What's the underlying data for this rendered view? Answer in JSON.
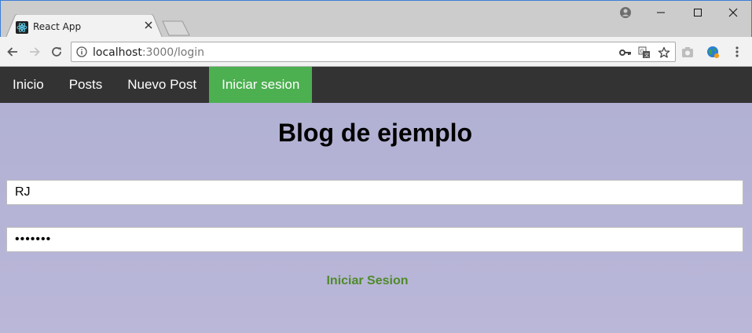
{
  "browser": {
    "tab_title": "React App",
    "url_host": "localhost",
    "url_path": ":3000/login",
    "icons": {
      "back": "arrow-left-icon",
      "forward": "arrow-right-icon",
      "reload": "reload-icon",
      "info": "info-icon",
      "key": "key-icon",
      "translate": "translate-icon",
      "bookmark": "star-icon",
      "menu": "kebab-menu-icon"
    }
  },
  "site": {
    "nav": [
      {
        "label": "Inicio"
      },
      {
        "label": "Posts"
      },
      {
        "label": "Nuevo Post"
      },
      {
        "label": "Iniciar sesion",
        "active": true
      }
    ],
    "title": "Blog de ejemplo",
    "form": {
      "username_value": "RJ",
      "password_value": "•••••••",
      "submit_label": "Iniciar Sesion"
    },
    "colors": {
      "nav_bg": "#333333",
      "nav_active": "#4caf50",
      "page_bg": "#b4b2d5",
      "button_text": "#4f8a2a"
    }
  }
}
